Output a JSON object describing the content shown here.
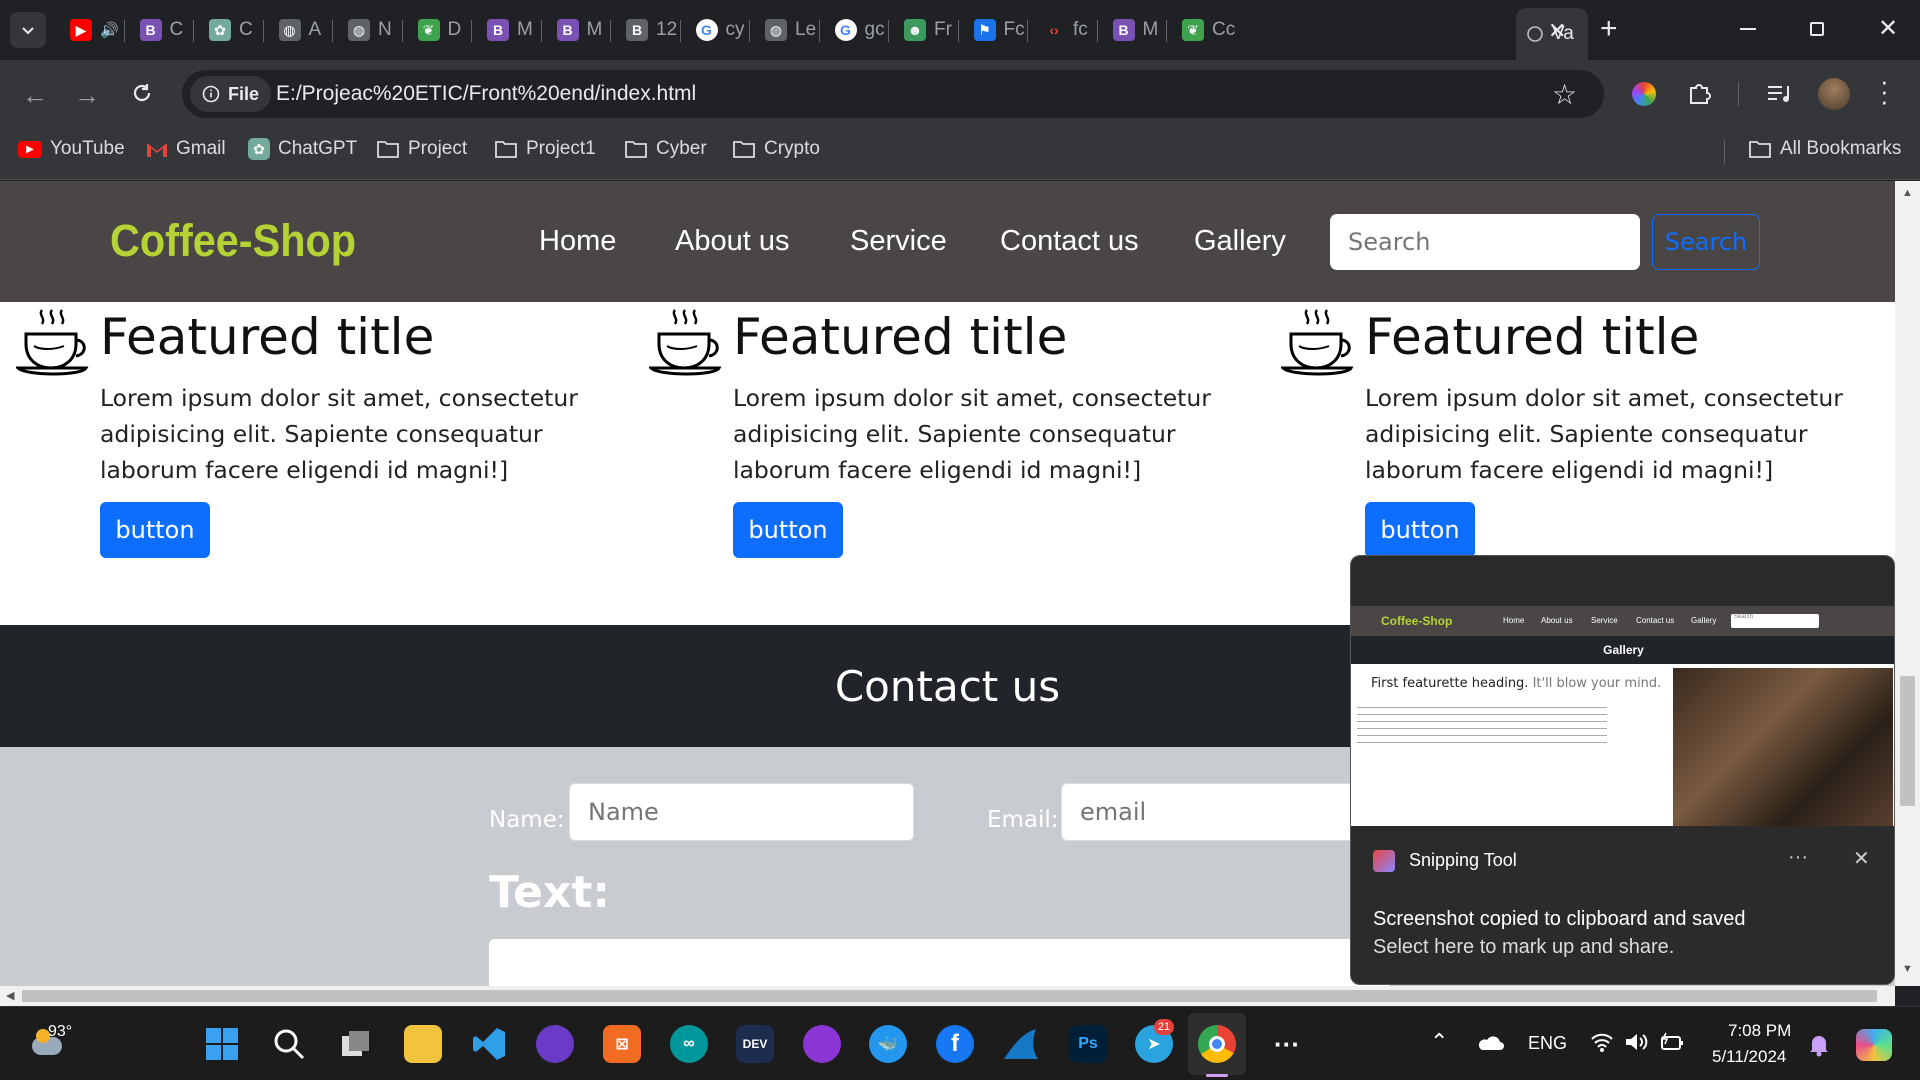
{
  "browser": {
    "tabs": [
      {
        "label": "",
        "icon": "youtube-icon"
      },
      {
        "label": "C",
        "icon": "bootstrap-icon"
      },
      {
        "label": "C",
        "icon": "chatgpt-icon"
      },
      {
        "label": "A",
        "icon": "globe-icon"
      },
      {
        "label": "N",
        "icon": "globe-icon"
      },
      {
        "label": "D",
        "icon": "leaf-icon"
      },
      {
        "label": "M",
        "icon": "bootstrap-icon"
      },
      {
        "label": "M",
        "icon": "bootstrap-icon"
      },
      {
        "label": "12",
        "icon": "b-icon"
      },
      {
        "label": "cy",
        "icon": "google-icon"
      },
      {
        "label": "Le",
        "icon": "globe-icon"
      },
      {
        "label": "gc",
        "icon": "google-icon"
      },
      {
        "label": "Fr",
        "icon": "robot-icon"
      },
      {
        "label": "Fc",
        "icon": "flag-icon"
      },
      {
        "label": "fc",
        "icon": "code-icon"
      },
      {
        "label": "M",
        "icon": "bootstrap-icon"
      },
      {
        "label": "Cc",
        "icon": "leaf-icon"
      }
    ],
    "active_tab": "Va",
    "address": {
      "scheme_badge": "File",
      "url": "E:/Projeac%20ETIC/Front%20end/index.html"
    },
    "bookmarks": [
      "YouTube",
      "Gmail",
      "ChatGPT",
      "Project",
      "Project1",
      "Cyber",
      "Crypto"
    ],
    "all_bookmarks": "All Bookmarks"
  },
  "site": {
    "brand": "Coffee-Shop",
    "nav": [
      "Home",
      "About us",
      "Service",
      "Contact us",
      "Gallery"
    ],
    "search_placeholder": "Search",
    "search_button": "Search",
    "features": [
      {
        "title": "Featured title",
        "text": "Lorem ipsum dolor sit amet, consectetur adipisicing elit. Sapiente consequatur laborum facere eligendi id magni!]",
        "button": "button"
      },
      {
        "title": "Featured title",
        "text": "Lorem ipsum dolor sit amet, consectetur adipisicing elit. Sapiente consequatur laborum facere eligendi id magni!]",
        "button": "button"
      },
      {
        "title": "Featured title",
        "text": "Lorem ipsum dolor sit amet, consectetur adipisicing elit. Sapiente consequatur laborum facere eligendi id magni!]",
        "button": "button"
      }
    ],
    "contact": {
      "heading": "Contact us",
      "name_label": "Name:",
      "name_placeholder": "Name",
      "email_label": "Email:",
      "email_placeholder": "email",
      "text_label": "Text:"
    }
  },
  "notification": {
    "app": "Snipping Tool",
    "more": "···",
    "title": "Screenshot copied to clipboard and saved",
    "subtitle": "Select here to mark up and share.",
    "thumb": {
      "brand": "Coffee-Shop",
      "nav": [
        "Home",
        "About us",
        "Service",
        "Contact us",
        "Gallery"
      ],
      "search": "Search",
      "gallery_title": "Gallery",
      "heading": "First featurette heading.",
      "heading_muted": "It'll blow your mind."
    }
  },
  "taskbar": {
    "weather": "93°",
    "lang": "ENG",
    "time": "7:08 PM",
    "date": "5/11/2024",
    "telegram_badge": "21",
    "devcc_label": "DEV",
    "ps_label": "Ps"
  },
  "colors": {
    "brand": "#b5d334",
    "primary": "#0d6efd",
    "nav_bg": "#4a4646",
    "contact_bg": "#212529"
  }
}
